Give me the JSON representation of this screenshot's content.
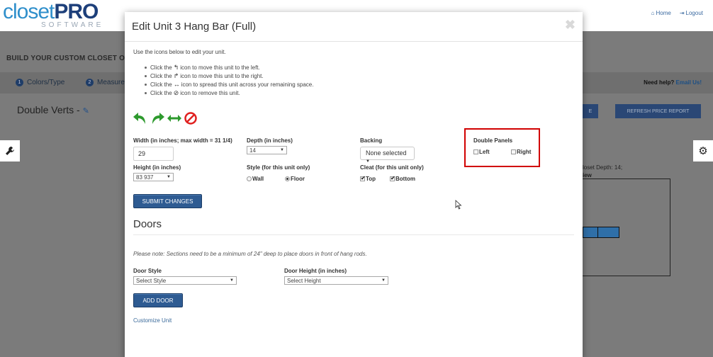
{
  "logo": {
    "closet": "closet",
    "pro": "PRO",
    "software": "SOFTWARE"
  },
  "toplinks": {
    "home": "Home",
    "logout": "Logout"
  },
  "background": {
    "build_title": "BUILD YOUR CUSTOM CLOSET O",
    "tabs": [
      {
        "num": "1",
        "label": "Colors/Type"
      },
      {
        "num": "2",
        "label": "Measure"
      }
    ],
    "help_text": "Need help?",
    "help_link": "Email Us!",
    "page_title": "Double Verts -",
    "btn_partial": "E",
    "refresh_button": "REFRESH PRICE REPORT",
    "closet_depth": "loset Depth: 14;",
    "view_label": "iew"
  },
  "modal": {
    "title": "Edit Unit 3 Hang Bar (Full)",
    "close": "✖",
    "intro": "Use the icons below to edit your unit.",
    "instructions": [
      {
        "pre": "Click the",
        "icon": "↰",
        "post": "icon to move this unit to the left."
      },
      {
        "pre": "Click the",
        "icon": "↱",
        "post": "icon to move this unit to the right."
      },
      {
        "pre": "Click the",
        "icon": "↔",
        "post": "icon to spread this unit across your remaining space."
      },
      {
        "pre": "Click the",
        "icon": "⊘",
        "post": "icon to remove this unit."
      }
    ],
    "width": {
      "label": "Width (in inches; max width = 31 1/4)",
      "value": "29"
    },
    "height": {
      "label": "Height (in inches)",
      "value": "83 937"
    },
    "depth": {
      "label": "Depth (in inches)",
      "value": "14"
    },
    "style": {
      "label": "Style (for this unit only)",
      "wall": "Wall",
      "floor": "Floor"
    },
    "backing": {
      "label": "Backing",
      "value": "None selected"
    },
    "cleat": {
      "label": "Cleat (for this unit only)",
      "top": "Top",
      "bottom": "Bottom"
    },
    "double_panels": {
      "label": "Double Panels",
      "left": "Left",
      "right": "Right"
    },
    "submit": "SUBMIT CHANGES",
    "doors": {
      "heading": "Doors",
      "note": "Please note: Sections need to be a minimum of 24\" deep to place doors in front of hang rods.",
      "style_label": "Door Style",
      "style_value": "Select Style",
      "height_label": "Door Height (in inches)",
      "height_value": "Select Height",
      "add_button": "ADD DOOR"
    },
    "customize_link": "Customize Unit"
  },
  "colors": {
    "green": "#2e9a2e",
    "red": "#e0201f",
    "button_blue": "#2e5b92",
    "highlight": "#d10000"
  }
}
